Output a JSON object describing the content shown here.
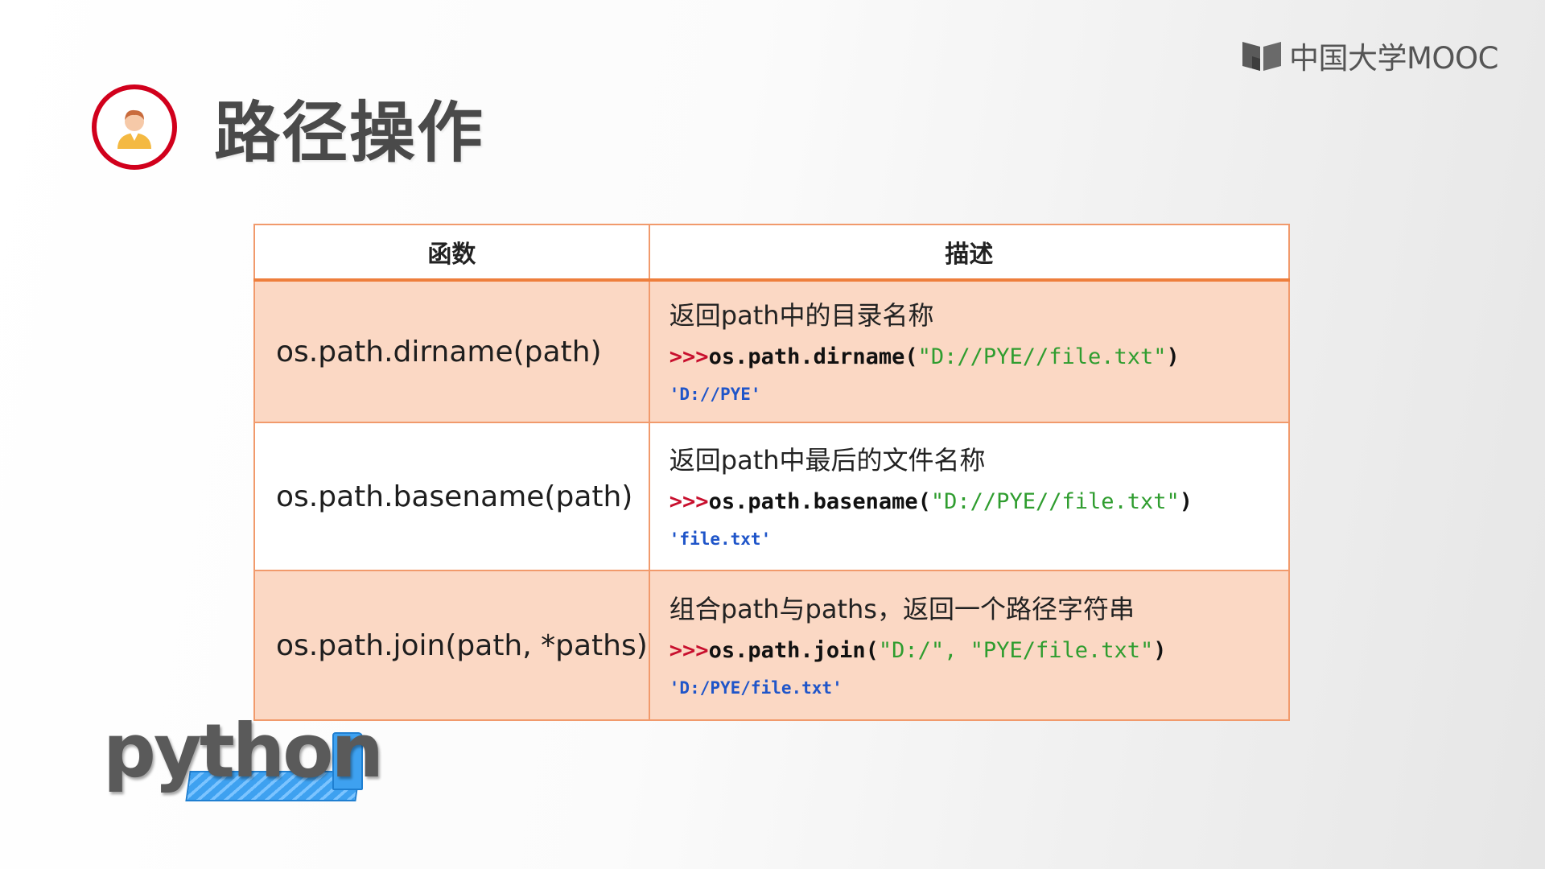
{
  "brand": {
    "name": "中国大学MOOC",
    "icon": "mooc-book-icon"
  },
  "header": {
    "title": "路径操作",
    "avatar_icon": "teacher-avatar-icon",
    "avatar_ring_color": "#d1001c"
  },
  "table": {
    "headers": [
      "函数",
      "描述"
    ],
    "accent_color": "#ee7e3c",
    "row_fill_color": "#fbd8c4",
    "rows": [
      {
        "function": "os.path.dirname(path)",
        "description": "返回path中的目录名称",
        "code_prompt": ">>>",
        "code_call": "os.path.dirname(",
        "code_args": "\"D://PYE//file.txt\"",
        "code_close": ")",
        "result": "'D://PYE'"
      },
      {
        "function": "os.path.basename(path)",
        "description": "返回path中最后的文件名称",
        "code_prompt": ">>>",
        "code_call": "os.path.basename(",
        "code_args": "\"D://PYE//file.txt\"",
        "code_close": ")",
        "result": "'file.txt'"
      },
      {
        "function": "os.path.join(path, *paths)",
        "description": "组合path与paths，返回一个路径字符串",
        "code_prompt": ">>>",
        "code_call": "os.path.join(",
        "code_args": "\"D:/\", \"PYE/file.txt\"",
        "code_close": ")",
        "result": "'D:/PYE/file.txt'"
      }
    ]
  },
  "footer_logo": {
    "text": "python",
    "icon": "python-logo"
  }
}
